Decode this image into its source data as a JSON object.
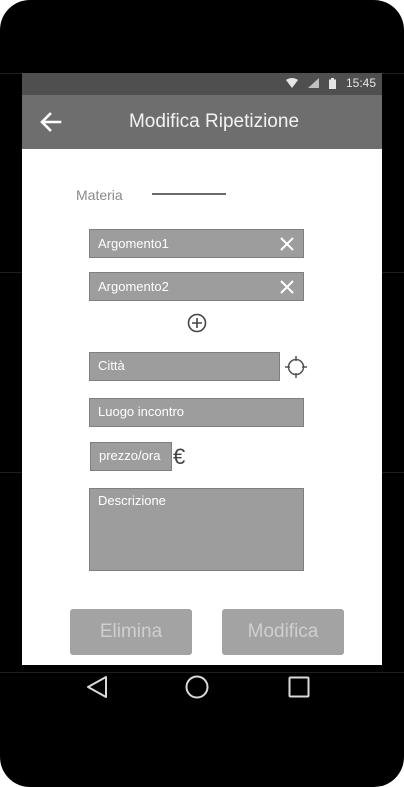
{
  "status_bar": {
    "time": "15:45",
    "icons": [
      "wifi-icon",
      "signal-icon",
      "battery-icon"
    ]
  },
  "app_bar": {
    "title": "Modifica Ripetizione",
    "back_icon": "arrow-left-icon"
  },
  "form": {
    "materia_label": "Materia",
    "topics": [
      {
        "label": "Argomento1"
      },
      {
        "label": "Argomento2"
      }
    ],
    "add_topic_icon": "plus-circle-icon",
    "city_placeholder": "Città",
    "city_icon": "crosshair-icon",
    "meeting_place_placeholder": "Luogo incontro",
    "price_placeholder": "prezzo/ora",
    "currency_symbol": "€",
    "description_placeholder": "Descrizione"
  },
  "actions": {
    "delete_label": "Elimina",
    "edit_label": "Modifica"
  },
  "nav_bar": {
    "icons": [
      "back-triangle-icon",
      "home-circle-icon",
      "recents-square-icon"
    ]
  },
  "colors": {
    "status_bar": "#4f4f4f",
    "app_bar": "#6e6e6e",
    "field_fill": "#9d9d9d",
    "button_fill": "#a3a3a3"
  }
}
